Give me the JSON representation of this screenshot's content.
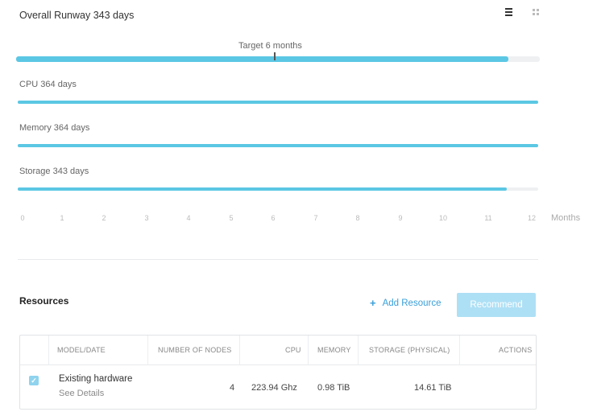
{
  "runway": {
    "overall_label": "Overall Runway 343 days",
    "overall_fraction": 0.94,
    "target_label": "Target 6 months",
    "target_months": 6,
    "metrics": [
      {
        "label": "CPU 364 days",
        "fraction": 1.0
      },
      {
        "label": "Memory 364 days",
        "fraction": 1.0
      },
      {
        "label": "Storage 343 days",
        "fraction": 0.94
      }
    ],
    "axis_ticks": [
      "0",
      "1",
      "2",
      "3",
      "4",
      "5",
      "6",
      "7",
      "8",
      "9",
      "10",
      "11",
      "12"
    ],
    "axis_unit": "Months",
    "bar_color": "#5bc7e4",
    "track_color": "#eef0f2"
  },
  "view_toggle": {
    "list_icon": "list-view-icon",
    "grid_icon": "grid-view-icon"
  },
  "resources": {
    "title": "Resources",
    "add_label": "Add Resource",
    "add_icon": "plus-icon",
    "recommend_label": "Recommend",
    "columns": {
      "model": "MODEL/DATE",
      "nodes": "NUMBER OF NODES",
      "cpu": "CPU",
      "memory": "MEMORY",
      "storage": "STORAGE (PHYSICAL)",
      "actions": "ACTIONS"
    },
    "rows": [
      {
        "checked": true,
        "model": "Existing hardware",
        "details": "See Details",
        "nodes": "4",
        "cpu": "223.94 Ghz",
        "memory": "0.98 TiB",
        "storage": "14.61 TiB"
      }
    ]
  }
}
